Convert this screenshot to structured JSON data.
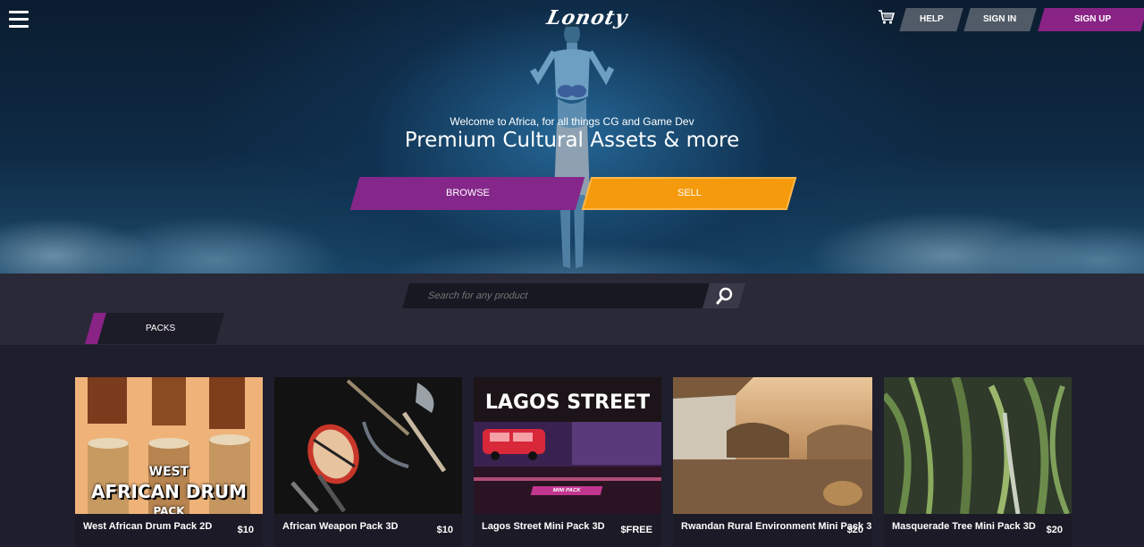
{
  "header": {
    "logo_text": "Lonoty",
    "nav": {
      "help": "HELP",
      "sign_in": "SIGN IN",
      "sign_up": "SIGN UP"
    },
    "icons": {
      "menu": "hamburger-menu-icon",
      "cart": "shopping-cart-icon"
    }
  },
  "hero": {
    "welcome": "Welcome to Africa, for all things CG and Game Dev",
    "headline": "Premium Cultural Assets & more",
    "browse_label": "BROWSE",
    "sell_label": "SELL"
  },
  "search": {
    "placeholder": "Search for any product",
    "icon": "search-icon"
  },
  "tabs": {
    "packs": "PACKS"
  },
  "products": [
    {
      "title": "West African Drum Pack 2D",
      "price": "$10",
      "thumb_text": [
        "WEST",
        "AFRICAN DRUM",
        "PACK"
      ]
    },
    {
      "title": "African Weapon Pack 3D",
      "price": "$10"
    },
    {
      "title": "Lagos Street Mini Pack 3D",
      "price": "$FREE",
      "thumb_text": [
        "LAGOS STREET",
        "MINI PACK"
      ]
    },
    {
      "title": "Rwandan Rural Environment Mini Pack 3D",
      "price": "$20"
    },
    {
      "title": "Masquerade Tree Mini Pack 3D",
      "price": "$20"
    }
  ],
  "colors": {
    "accent_purple": "#8a2386",
    "accent_orange": "#f59a0c",
    "nav_grey": "#515b67",
    "page_bg": "#1e1d2b"
  }
}
